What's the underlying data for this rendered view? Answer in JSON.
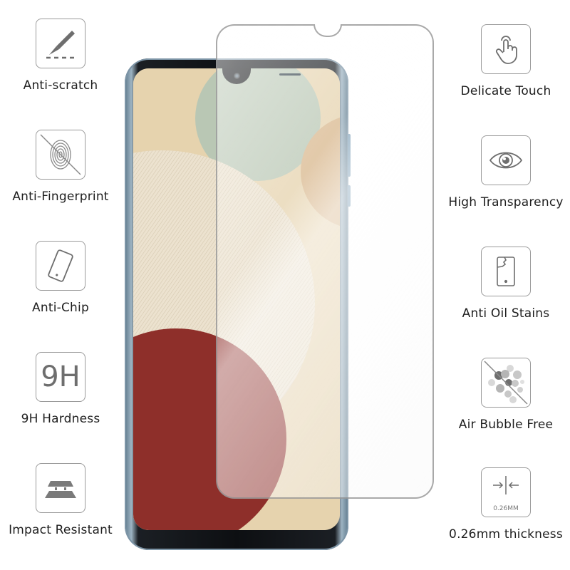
{
  "left_features": [
    {
      "icon": "scalpel-scratch-icon",
      "label": "Anti-scratch"
    },
    {
      "icon": "crossed-fingerprint-icon",
      "label": "Anti-Fingerprint"
    },
    {
      "icon": "tilted-phone-icon",
      "label": "Anti-Chip"
    },
    {
      "icon": "9h-text-icon",
      "icon_text": "9H",
      "label": "9H Hardness"
    },
    {
      "icon": "layered-plates-icon",
      "label": "Impact Resistant"
    }
  ],
  "right_features": [
    {
      "icon": "touch-hand-icon",
      "label": "Delicate Touch"
    },
    {
      "icon": "eye-icon",
      "label": "High Transparency"
    },
    {
      "icon": "cracked-phone-icon",
      "label": "Anti Oil Stains"
    },
    {
      "icon": "crossed-bubbles-icon",
      "label": "Air Bubble Free"
    },
    {
      "icon": "thickness-arrows-icon",
      "icon_text": "0.26MM",
      "label": "0.26mm thickness"
    }
  ],
  "colors": {
    "icon_stroke": "#9a9a9a",
    "icon_fill": "#6e6e6e",
    "label_text": "#1e1e1e",
    "phone_frame": "#7c94a6",
    "wallpaper_red": "#8e2f2a",
    "wallpaper_green": "#b9c7b4",
    "wallpaper_tan": "#d9b88e",
    "wallpaper_cream": "#ece2cf"
  }
}
